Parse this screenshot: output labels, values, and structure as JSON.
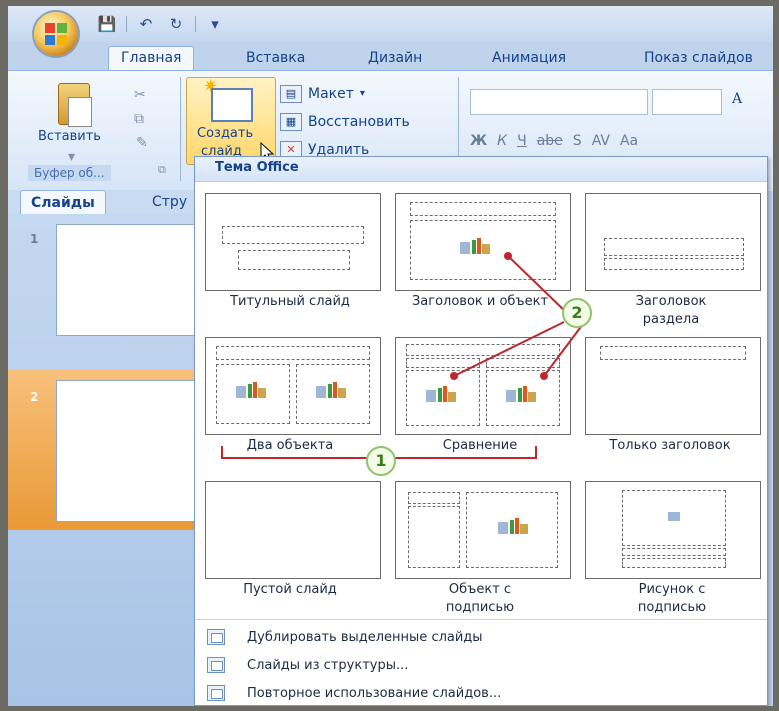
{
  "quick_access": {
    "save": "💾",
    "undo": "↶",
    "redo": "↻",
    "more": "▾"
  },
  "tabs": [
    "Главная",
    "Вставка",
    "Дизайн",
    "Анимация",
    "Показ слайдов"
  ],
  "ribbon": {
    "paste_label": "Вставить",
    "clipboard_group": "Буфер об...",
    "new_slide_label_1": "Создать",
    "new_slide_label_2": "слайд",
    "layout_label": "Макет",
    "reset_label": "Восстановить",
    "delete_label": "Удалить",
    "format_buttons": [
      "Ж",
      "К",
      "Ч",
      "abe",
      "S",
      "AV",
      "Aa"
    ]
  },
  "left_pane": {
    "tab_slides": "Слайды",
    "tab_outline": "Стру",
    "slides": [
      "1",
      "2"
    ]
  },
  "gallery": {
    "header": "Тема Office",
    "layouts": [
      {
        "label": "Титульный слайд"
      },
      {
        "label": "Заголовок и объект"
      },
      {
        "label": "Заголовок раздела"
      },
      {
        "label": "Два объекта"
      },
      {
        "label": "Сравнение"
      },
      {
        "label": "Только заголовок"
      },
      {
        "label": "Пустой слайд"
      },
      {
        "label": "Объект с подписью"
      },
      {
        "label": "Рисунок с подписью"
      }
    ],
    "footer": [
      "Дублировать выделенные слайды",
      "Слайды из структуры...",
      "Повторное использование слайдов..."
    ]
  },
  "callouts": {
    "one": "1",
    "two": "2"
  },
  "colors": {
    "accent": "#15428b",
    "callout_line": "#c0272d",
    "callout_border": "#8ec46b"
  }
}
